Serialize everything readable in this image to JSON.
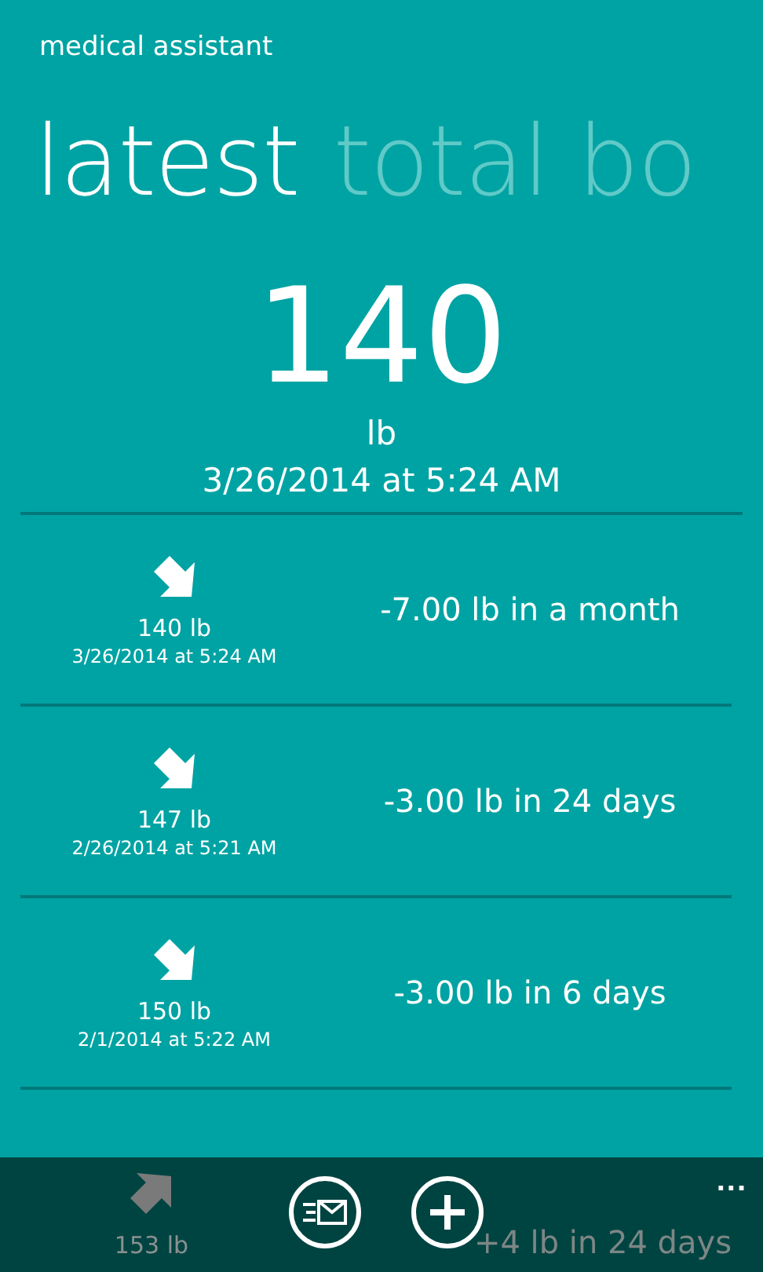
{
  "app_title": "medical assistant",
  "pivots": [
    {
      "label": "latest",
      "selected": true
    },
    {
      "label": "total bo",
      "selected": false
    }
  ],
  "latest": {
    "value": "140",
    "unit": "lb",
    "timestamp": "3/26/2014 at 5:24 AM"
  },
  "history": [
    {
      "kind": "decrease",
      "weight": "140 lb",
      "timestamp": "3/26/2014 at 5:24 AM",
      "change": "-7.00 lb in a month"
    },
    {
      "kind": "decrease",
      "weight": "147 lb",
      "timestamp": "2/26/2014 at 5:21 AM",
      "change": "-3.00 lb in 24 days"
    },
    {
      "kind": "decrease",
      "weight": "150 lb",
      "timestamp": "2/1/2014 at 5:22 AM",
      "change": "-3.00 lb in 6 days"
    },
    {
      "kind": "increase",
      "weight": "153 lb",
      "change": "+4 lb in 24 days"
    }
  ],
  "app_bar": {
    "buttons": [
      {
        "kind": "email"
      },
      {
        "kind": "add"
      }
    ],
    "more": "..."
  }
}
